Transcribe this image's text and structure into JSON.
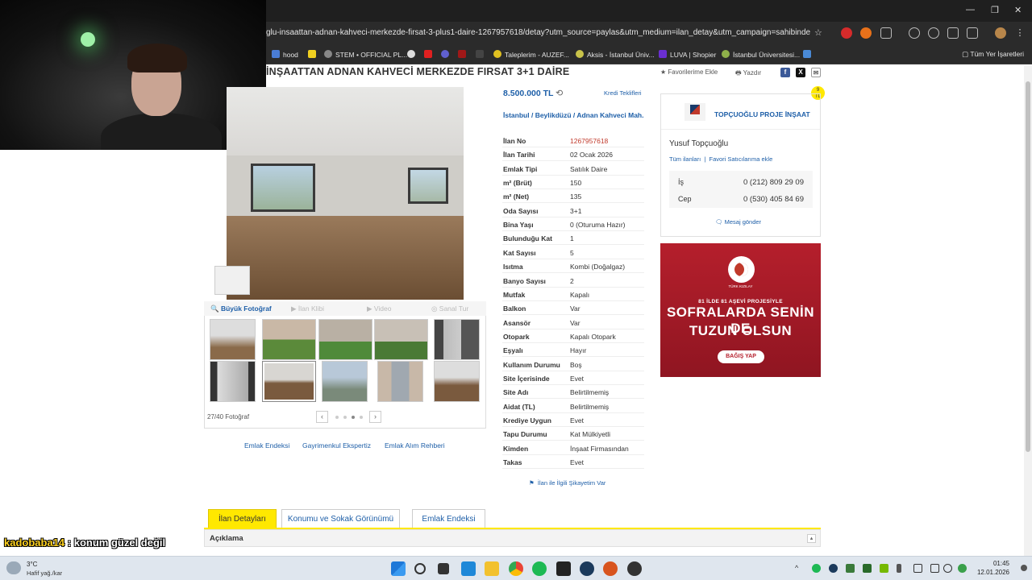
{
  "browser": {
    "url": "glu-insaattan-adnan-kahveci-merkezde-firsat-3-plus1-daire-1267957618/detay?utm_source=paylas&utm_medium=ilan_detay&utm_campaign=sahibinden_paylas...",
    "bookmarks": [
      "hood",
      "STEM • OFFICIAL PL...",
      "Taleplerim - AUZEF...",
      "Aksis - İstanbul Üniv...",
      "LUVA | Shopier",
      "İstanbul Üniversitesi..."
    ],
    "all_bookmarks": "Tüm Yer İşaretleri"
  },
  "listing": {
    "title": "İNŞAATTAN ADNAN KAHVECİ MERKEZDE FIRSAT 3+1 DAİRE",
    "favorite": "Favorilerime Ekle",
    "print": "Yazdır",
    "price": "8.500.000 TL",
    "kredi": "Kredi Teklifleri",
    "location": [
      "İstanbul",
      "Beylikdüzü",
      "Adnan Kahveci Mah."
    ],
    "details": [
      {
        "k": "İlan No",
        "v": "1267957618"
      },
      {
        "k": "İlan Tarihi",
        "v": "02 Ocak 2026"
      },
      {
        "k": "Emlak Tipi",
        "v": "Satılık Daire"
      },
      {
        "k": "m² (Brüt)",
        "v": "150"
      },
      {
        "k": "m² (Net)",
        "v": "135"
      },
      {
        "k": "Oda Sayısı",
        "v": "3+1"
      },
      {
        "k": "Bina Yaşı",
        "v": "0 (Oturuma Hazır)"
      },
      {
        "k": "Bulunduğu Kat",
        "v": "1"
      },
      {
        "k": "Kat Sayısı",
        "v": "5"
      },
      {
        "k": "Isıtma",
        "v": "Kombi (Doğalgaz)"
      },
      {
        "k": "Banyo Sayısı",
        "v": "2"
      },
      {
        "k": "Mutfak",
        "v": "Kapalı"
      },
      {
        "k": "Balkon",
        "v": "Var"
      },
      {
        "k": "Asansör",
        "v": "Var"
      },
      {
        "k": "Otopark",
        "v": "Kapalı Otopark"
      },
      {
        "k": "Eşyalı",
        "v": "Hayır"
      },
      {
        "k": "Kullanım Durumu",
        "v": "Boş"
      },
      {
        "k": "Site İçerisinde",
        "v": "Evet"
      },
      {
        "k": "Site Adı",
        "v": "Belirtilmemiş"
      },
      {
        "k": "Aidat (TL)",
        "v": "Belirtilmemiş"
      },
      {
        "k": "Krediye Uygun",
        "v": "Evet"
      },
      {
        "k": "Tapu Durumu",
        "v": "Kat Mülkiyetli"
      },
      {
        "k": "Kimden",
        "v": "İnşaat Firmasından"
      },
      {
        "k": "Takas",
        "v": "Evet"
      }
    ],
    "complaint": "İlan ile İlgili Şikayetim Var"
  },
  "media": {
    "tabs": [
      "Büyük Fotoğraf",
      "İlan Klibi",
      "Video",
      "Sanal Tur"
    ],
    "counter": "27/40 Fotoğraf",
    "prev": "‹",
    "next": "›"
  },
  "ext_links": [
    "Emlak Endeksi",
    "Gayrimenkul Ekspertiz",
    "Emlak Alım Rehberi"
  ],
  "seller": {
    "store": "TOPÇUOĞLU PROJE İNŞAAT",
    "name": "Yusuf Topçuoğlu",
    "all_listings": "Tüm ilanları",
    "fav_seller": "Favori Satıcılarıma ekle",
    "phones": [
      {
        "k": "İş",
        "v": "0 (212) 809 29 09"
      },
      {
        "k": "Cep",
        "v": "0 (530) 405 84 69"
      }
    ],
    "message": "Mesaj gönder"
  },
  "ad": {
    "org": "TÜRK KIZILAY",
    "sub": "81 İLDE 81 AŞEVİ PROJESİYLE",
    "line1": "SOFRALARDA SENİN DE",
    "line2": "TUZUN OLSUN",
    "button": "BAĞIŞ YAP"
  },
  "tabs": [
    "İlan Detayları",
    "Konumu ve Sokak Görünümü",
    "Emlak Endeksi"
  ],
  "section": "Açıklama",
  "chat": {
    "user": "kadobaba14",
    "message": ": konum güzel değil"
  },
  "taskbar": {
    "temp": "3°C",
    "weather": "Hafif yağ./kar",
    "time": "01:45",
    "date": "12.01.2026"
  },
  "colors": {
    "link": "#1e5fa8",
    "accent_yellow": "#ffe800",
    "id_red": "#c0392b",
    "ad_red": "#b51f2c"
  }
}
